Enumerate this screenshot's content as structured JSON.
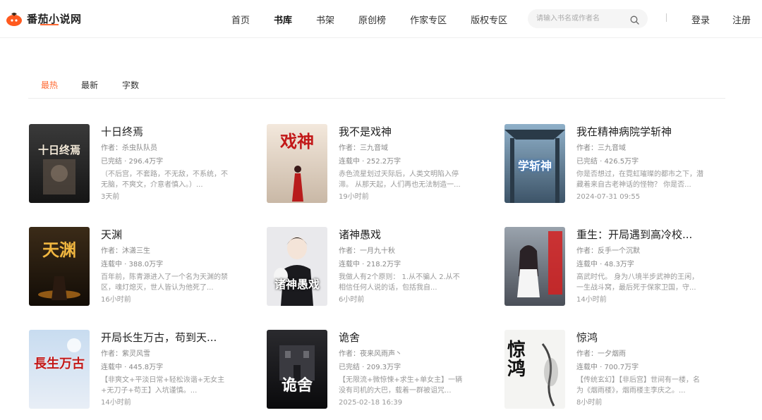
{
  "header": {
    "logo_text": "番茄小说网",
    "nav": [
      "首页",
      "书库",
      "书架",
      "原创榜",
      "作家专区",
      "版权专区"
    ],
    "active_nav": "书库",
    "search_placeholder": "请输入书名或作者名",
    "login": "登录",
    "register": "注册",
    "brand_color": "#ff6b35"
  },
  "tabs": [
    "最热",
    "最新",
    "字数"
  ],
  "active_tab": "最热",
  "books": [
    {
      "title": "十日终焉",
      "author": "作者：杀虫队队员",
      "status": "已完结 · 296.4万字",
      "desc": "（不后宫，不套路，不无敌，不系统，不无脑，不爽文，介意者慎入。）...",
      "time": "3天前",
      "cover_text": "十日终焉"
    },
    {
      "title": "我不是戏神",
      "author": "作者：三九音域",
      "status": "连载中 · 252.2万字",
      "desc": "赤色流星划过天际后，人类文明陷入停滞。 从那天起，人们再也无法制造一...",
      "time": "19小时前",
      "cover_text": "戏神"
    },
    {
      "title": "我在精神病院学斩神",
      "author": "作者：三九音域",
      "status": "已完结 · 426.5万字",
      "desc": "你是否想过，在霓虹璀璨的都市之下，潜藏着来自古老神话的怪物？ 你是否...",
      "time": "2024-07-31 09:55",
      "cover_text": "学斩神"
    },
    {
      "title": "天渊",
      "author": "作者：沐潇三生",
      "status": "连载中 · 388.0万字",
      "desc": "百年前，陈青源进入了一个名为天渊的禁区，魂灯熄灭，世人皆认为他死了...",
      "time": "16小时前",
      "cover_text": "天渊"
    },
    {
      "title": "诸神愚戏",
      "author": "作者：一月九十秋",
      "status": "连载中 · 218.2万字",
      "desc": "我做人有2个原则： 1.从不骗人 2.从不相信任何人说的话，包括我自...",
      "time": "6小时前",
      "cover_text": "诸神愚戏"
    },
    {
      "title": "重生：开局遇到高冷校...",
      "author": "作者：反手一个沉默",
      "status": "连载中 · 48.3万字",
      "desc": "高武时代。 身为八境半步武神的王闲，一生战斗窝，最后死于保家卫国，守...",
      "time": "14小时前",
      "cover_text": ""
    },
    {
      "title": "开局长生万古，苟到天...",
      "author": "作者：紫灵风雪",
      "status": "连载中 · 445.8万字",
      "desc": "【非爽文+平淡日常+轻松诙谐+无女主+无刀子+苟王】入坑谨慎。...",
      "time": "14小时前",
      "cover_text": "長生万古"
    },
    {
      "title": "诡舍",
      "author": "作者：夜来风雨声丶",
      "status": "已完结 · 209.3万字",
      "desc": "【无限流+微惊悚+求生+单女主】一辆没有司机的大巴，载着一群被诅咒...",
      "time": "2025-02-18 16:39",
      "cover_text": "诡舍"
    },
    {
      "title": "惊鸿",
      "author": "作者：一夕烟雨",
      "status": "连载中 · 700.7万字",
      "desc": "【传统玄幻】【非后宫】世间有一楼，名为《烟雨楼》，烟雨楼主李庆之。...",
      "time": "8小时前",
      "cover_text": "惊鸿"
    }
  ]
}
